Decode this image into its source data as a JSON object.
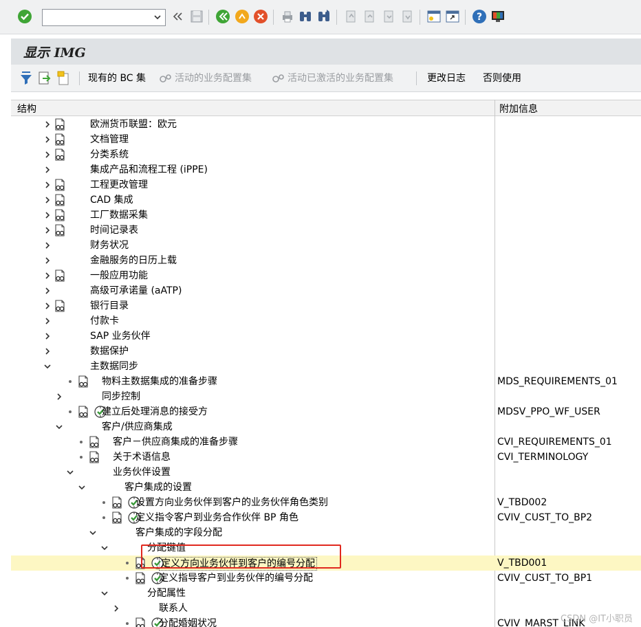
{
  "window": {
    "title": "显示 IMG"
  },
  "systembar": {
    "command_value": ""
  },
  "apptoolbar": {
    "items": [
      {
        "label": "现有的 BC 集",
        "enabled": true
      },
      {
        "label": "活动的业务配置集",
        "enabled": false
      },
      {
        "label": "活动已激活的业务配置集",
        "enabled": false
      },
      {
        "label": "更改日志",
        "enabled": true
      },
      {
        "label": "否则使用",
        "enabled": true
      }
    ]
  },
  "tree": {
    "col_structure": "结构",
    "col_info": "附加信息",
    "rows": [
      {
        "label": "欧洲货币联盟：欧元",
        "info": "",
        "toggle": "collapsed",
        "docs": true,
        "exec": false,
        "level": 0
      },
      {
        "label": "文档管理",
        "info": "",
        "toggle": "collapsed",
        "docs": true,
        "exec": false,
        "level": 0
      },
      {
        "label": "分类系统",
        "info": "",
        "toggle": "collapsed",
        "docs": true,
        "exec": false,
        "level": 0
      },
      {
        "label": "集成产品和流程工程 (iPPE)",
        "info": "",
        "toggle": "collapsed",
        "docs": false,
        "exec": false,
        "level": 0
      },
      {
        "label": "工程更改管理",
        "info": "",
        "toggle": "collapsed",
        "docs": true,
        "exec": false,
        "level": 0
      },
      {
        "label": "CAD 集成",
        "info": "",
        "toggle": "collapsed",
        "docs": true,
        "exec": false,
        "level": 0
      },
      {
        "label": "工厂数据采集",
        "info": "",
        "toggle": "collapsed",
        "docs": true,
        "exec": false,
        "level": 0
      },
      {
        "label": "时间记录表",
        "info": "",
        "toggle": "collapsed",
        "docs": true,
        "exec": false,
        "level": 0
      },
      {
        "label": "财务状况",
        "info": "",
        "toggle": "collapsed",
        "docs": false,
        "exec": false,
        "level": 0
      },
      {
        "label": "金融服务的日历上载",
        "info": "",
        "toggle": "collapsed",
        "docs": false,
        "exec": false,
        "level": 0
      },
      {
        "label": "一般应用功能",
        "info": "",
        "toggle": "collapsed",
        "docs": true,
        "exec": false,
        "level": 0
      },
      {
        "label": "高级可承诺量 (aATP)",
        "info": "",
        "toggle": "collapsed",
        "docs": false,
        "exec": false,
        "level": 0
      },
      {
        "label": "银行目录",
        "info": "",
        "toggle": "collapsed",
        "docs": true,
        "exec": false,
        "level": 0
      },
      {
        "label": "付款卡",
        "info": "",
        "toggle": "collapsed",
        "docs": false,
        "exec": false,
        "level": 0
      },
      {
        "label": "SAP 业务伙伴",
        "info": "",
        "toggle": "collapsed",
        "docs": false,
        "exec": false,
        "level": 0
      },
      {
        "label": "数据保护",
        "info": "",
        "toggle": "collapsed",
        "docs": false,
        "exec": false,
        "level": 0
      },
      {
        "label": "主数据同步",
        "info": "",
        "toggle": "expanded",
        "docs": false,
        "exec": false,
        "level": 0
      },
      {
        "label": "物料主数据集成的准备步骤",
        "info": "MDS_REQUIREMENTS_01",
        "toggle": "leaf",
        "docs": true,
        "exec": false,
        "level": 1
      },
      {
        "label": "同步控制",
        "info": "",
        "toggle": "collapsed",
        "docs": false,
        "exec": false,
        "level": 1
      },
      {
        "label": "建立后处理消息的接受方",
        "info": "MDSV_PPO_WF_USER",
        "toggle": "leaf",
        "docs": true,
        "exec": true,
        "level": 1
      },
      {
        "label": "客户/供应商集成",
        "info": "",
        "toggle": "expanded",
        "docs": false,
        "exec": false,
        "level": 1
      },
      {
        "label": "客户－供应商集成的准备步骤",
        "info": "CVI_REQUIREMENTS_01",
        "toggle": "leaf",
        "docs": true,
        "exec": false,
        "level": 2
      },
      {
        "label": "关于术语信息",
        "info": "CVI_TERMINOLOGY",
        "toggle": "leaf",
        "docs": true,
        "exec": false,
        "level": 2
      },
      {
        "label": "业务伙伴设置",
        "info": "",
        "toggle": "expanded",
        "docs": false,
        "exec": false,
        "level": 2
      },
      {
        "label": "客户集成的设置",
        "info": "",
        "toggle": "expanded",
        "docs": false,
        "exec": false,
        "level": 3
      },
      {
        "label": "设置方向业务伙伴到客户的业务伙伴角色类别",
        "info": "V_TBD002",
        "toggle": "leaf",
        "docs": true,
        "exec": true,
        "level": 4
      },
      {
        "label": "定义指令客户到业务合作伙伴 BP 角色",
        "info": "CVIV_CUST_TO_BP2",
        "toggle": "leaf",
        "docs": true,
        "exec": true,
        "level": 4
      },
      {
        "label": "客户集成的字段分配",
        "info": "",
        "toggle": "expanded",
        "docs": false,
        "exec": false,
        "level": 4
      },
      {
        "label": "分配键值",
        "info": "",
        "toggle": "expanded",
        "docs": false,
        "exec": false,
        "level": 5
      },
      {
        "label": "定义方向业务伙伴到客户的编号分配",
        "info": "V_TBD001",
        "toggle": "leaf",
        "docs": true,
        "exec": true,
        "level": 6,
        "selected": true
      },
      {
        "label": "定义指导客户到业务伙伴的编号分配",
        "info": "CVIV_CUST_TO_BP1",
        "toggle": "leaf",
        "docs": true,
        "exec": true,
        "level": 6
      },
      {
        "label": "分配属性",
        "info": "",
        "toggle": "expanded",
        "docs": false,
        "exec": false,
        "level": 5
      },
      {
        "label": "联系人",
        "info": "",
        "toggle": "collapsed",
        "docs": false,
        "exec": false,
        "level": 6
      },
      {
        "label": "分配婚姻状况",
        "info": "CVIV_MARST_LINK",
        "toggle": "leaf",
        "docs": true,
        "exec": true,
        "level": 6
      }
    ]
  },
  "watermark": "CSDN @IT小职员",
  "colors": {
    "selected_row": "#fdf7c3",
    "highlight_box": "#e0281e",
    "exec_icon": "#3a9a3a"
  }
}
